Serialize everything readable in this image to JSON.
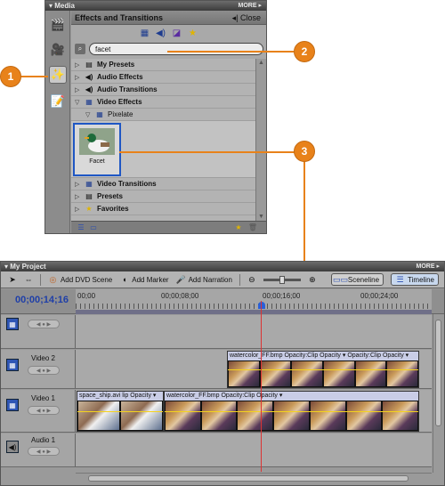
{
  "media_panel": {
    "title": "Media",
    "more_label": "MORE",
    "sidebar_icons": [
      "film-strip-icon",
      "camera-icon",
      "effects-icon",
      "titles-icon"
    ],
    "effects": {
      "header_title": "Effects and Transitions",
      "close_label": "Close",
      "type_buttons": [
        "video-effects-icon",
        "audio-effects-icon",
        "transitions-icon",
        "favorites-star-icon"
      ],
      "search_value": "facet",
      "list": [
        {
          "label": "My Presets",
          "expanded": false
        },
        {
          "label": "Audio Effects",
          "expanded": false
        },
        {
          "label": "Audio Transitions",
          "expanded": false
        },
        {
          "label": "Video Effects",
          "expanded": true
        }
      ],
      "sub_category": "Pixelate",
      "thumbnail_label": "Facet",
      "list_after": [
        {
          "label": "Video Transitions"
        },
        {
          "label": "Presets"
        },
        {
          "label": "Favorites"
        }
      ]
    }
  },
  "callouts": [
    "1",
    "2",
    "3"
  ],
  "project": {
    "title": "My Project",
    "more_label": "MORE",
    "toolbar": {
      "add_dvd_scene": "Add DVD Scene",
      "add_marker": "Add Marker",
      "add_narration": "Add Narration",
      "sceneline": "Sceneline",
      "timeline": "Timeline"
    },
    "timecode": "00;00;14;16",
    "ruler_labels": [
      "00;00",
      "00;00;08;00",
      "00;00;16;00",
      "00;00;24;00"
    ],
    "tracks": {
      "video2": "Video 2",
      "video1": "Video 1",
      "audio1": "Audio 1"
    },
    "clips": {
      "v2_clip_a": "watercolor_FF.bmp",
      "v2_clip_b": "Opacity:Clip Opacity ▾",
      "v2_clip_c": "Opacity:Clip Opacity ▾",
      "v1_clip_a": "space_ship.avi",
      "v1_clip_b": "lip Opacity ▾",
      "v1_clip_c": "watercolor_FF.bmp",
      "v1_clip_d": "Opacity:Clip Opacity ▾"
    }
  },
  "colors": {
    "callout": "#e8821a",
    "playhead": "#dd3333",
    "selection": "#1f57c4",
    "timecode": "#1f3fa8"
  }
}
